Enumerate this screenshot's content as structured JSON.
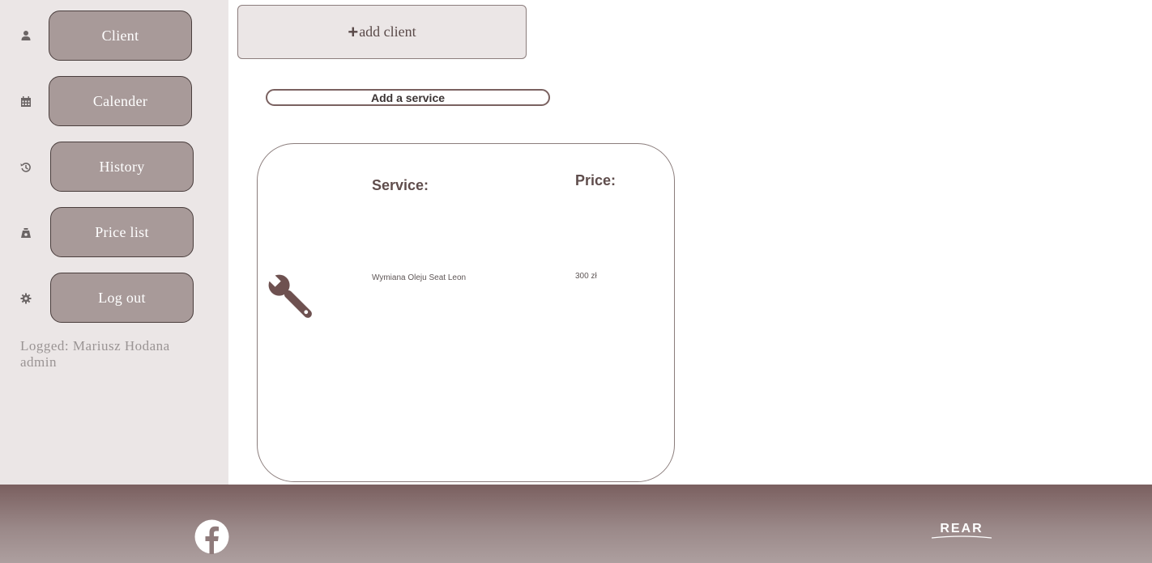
{
  "sidebar": {
    "items": [
      {
        "label": "Client",
        "icon": "user-icon"
      },
      {
        "label": "Calender",
        "icon": "calendar-icon"
      },
      {
        "label": "History",
        "icon": "history-icon"
      },
      {
        "label": "Price list",
        "icon": "money-bag-icon"
      },
      {
        "label": "Log out",
        "icon": "gear-icon"
      }
    ],
    "logged_text": "Logged: Mariusz Hodana",
    "role": "admin"
  },
  "actions": {
    "add_client_plus": "+",
    "add_client_label": "add client",
    "add_service_label": "Add a service"
  },
  "services": {
    "headers": {
      "service": "Service:",
      "price": "Price:"
    },
    "rows": [
      {
        "service": "Wymiana Oleju Seat Leon",
        "price": "300 zł",
        "icon": "wrench-icon"
      }
    ]
  },
  "footer": {
    "social_icon": "facebook-icon",
    "logo_text": "REAR"
  },
  "colors": {
    "sidebar_bg": "#ebe6e6",
    "nav_button": "#a89a99",
    "accent": "#6e5150",
    "footer_top": "#7a5f5f"
  }
}
